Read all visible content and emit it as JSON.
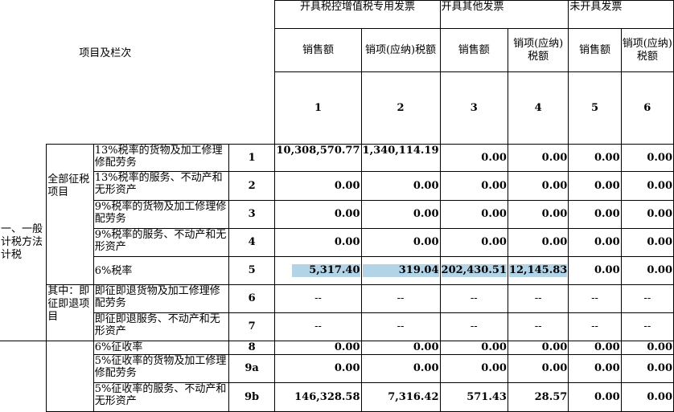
{
  "header": {
    "title": "项目及栏次",
    "group1": "开具税控增值税专用发票",
    "group2": "开具其他发票",
    "group3": "未开具发票",
    "sales": "销售额",
    "tax": "销项(应纳)税额",
    "col_nums": [
      "1",
      "2",
      "3",
      "4",
      "5",
      "6"
    ]
  },
  "section1": {
    "label": "一、一般计税方法计税",
    "sub_all": "全部征税项目",
    "sub_instant": "其中：即征即退项目"
  },
  "rows": [
    {
      "desc": "13%税率的货物及加工修理修配劳务",
      "line": "1",
      "v": [
        "10,308,570.77",
        "1,340,114.19",
        "0.00",
        "0.00",
        "0.00",
        "0.00"
      ]
    },
    {
      "desc": "13%税率的服务、不动产和无形资产",
      "line": "2",
      "v": [
        "0.00",
        "0.00",
        "0.00",
        "0.00",
        "0.00",
        "0.00"
      ]
    },
    {
      "desc": "9%税率的货物及加工修理修配劳务",
      "line": "3",
      "v": [
        "0.00",
        "0.00",
        "0.00",
        "0.00",
        "0.00",
        "0.00"
      ]
    },
    {
      "desc": "9%税率的服务、不动产和无形资产",
      "line": "4",
      "v": [
        "0.00",
        "0.00",
        "0.00",
        "0.00",
        "0.00",
        "0.00"
      ]
    },
    {
      "desc": "6%税率",
      "line": "5",
      "v": [
        "5,317.40",
        "319.04",
        "202,430.51",
        "12,145.83",
        "0.00",
        "0.00"
      ]
    },
    {
      "desc": "即征即退货物及加工修理修配劳务",
      "line": "6",
      "v": [
        "--",
        "--",
        "--",
        "--",
        "--",
        "--"
      ]
    },
    {
      "desc": "即征即退服务、不动产和无形资产",
      "line": "7",
      "v": [
        "--",
        "--",
        "--",
        "--",
        "--",
        "--"
      ]
    },
    {
      "desc": "6%征收率",
      "line": "8",
      "v": [
        "0.00",
        "0.00",
        "0.00",
        "0.00",
        "0.00",
        "0.00"
      ]
    },
    {
      "desc": "5%征收率的货物及加工修理修配劳务",
      "line": "9a",
      "v": [
        "0.00",
        "0.00",
        "0.00",
        "0.00",
        "0.00",
        "0.00"
      ]
    },
    {
      "desc": "5%征收率的服务、不动产和无形资产",
      "line": "9b",
      "v": [
        "146,328.58",
        "7,316.42",
        "571.43",
        "28.57",
        "0.00",
        "0.00"
      ]
    }
  ]
}
